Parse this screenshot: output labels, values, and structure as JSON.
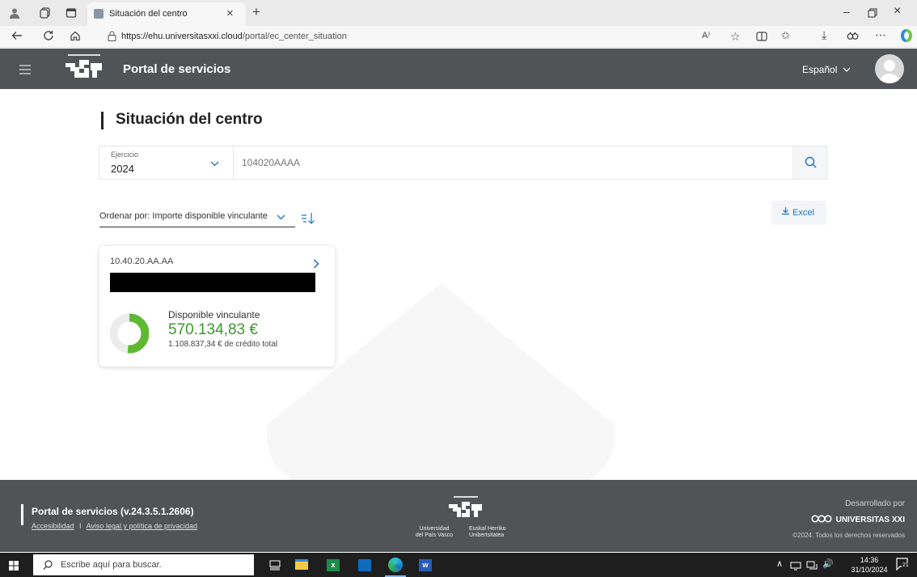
{
  "browser": {
    "tab_title": "Situación del centro",
    "tab_close": "×",
    "new_tab": "+",
    "url_host": "https://ehu.universitasxxi.cloud",
    "url_path": "/portal/ec_center_situation",
    "read_aloud": "A⁾"
  },
  "header": {
    "app_name": "Portal de servicios",
    "language": "Español"
  },
  "page": {
    "title": "Situación del centro",
    "exercise_label": "Ejercicio",
    "exercise_value": "2024",
    "search_value": "104020AAAA",
    "sort_label": "Ordenar por: Importe disponible vinculante",
    "excel_label": "Excel"
  },
  "card": {
    "code": "10.40.20.AA.AA",
    "stat_label": "Disponible vinculante",
    "stat_value": "570.134,83 €",
    "stat_sub": "1.108.837,34 € de crédito total",
    "ratio": 0.5142
  },
  "footer": {
    "version": "Portal de servicios (v.24.3.5.1.2606)",
    "link_accessibility": "Accesibilidad",
    "separator": "I",
    "link_legal": "Aviso legal y política de privacidad",
    "uni_es_1": "Universidad",
    "uni_es_2": "del País Vasco",
    "uni_eu_1": "Euskal Herriko",
    "uni_eu_2": "Unibertsitatea",
    "developed_by": "Desarrollado por",
    "brand": "UNIVERSITAS XXI",
    "copyright": "©2024. Todos los derechos reservados"
  },
  "taskbar": {
    "search_placeholder": "Escribe aquí para buscar.",
    "time": "14:36",
    "date": "31/10/2024",
    "notifications": "21"
  },
  "colors": {
    "header_bg": "#515456",
    "accent_blue": "#1a73c9",
    "value_green": "#3a9a2a",
    "donut_green": "#5fb832",
    "donut_track": "#ececec"
  }
}
